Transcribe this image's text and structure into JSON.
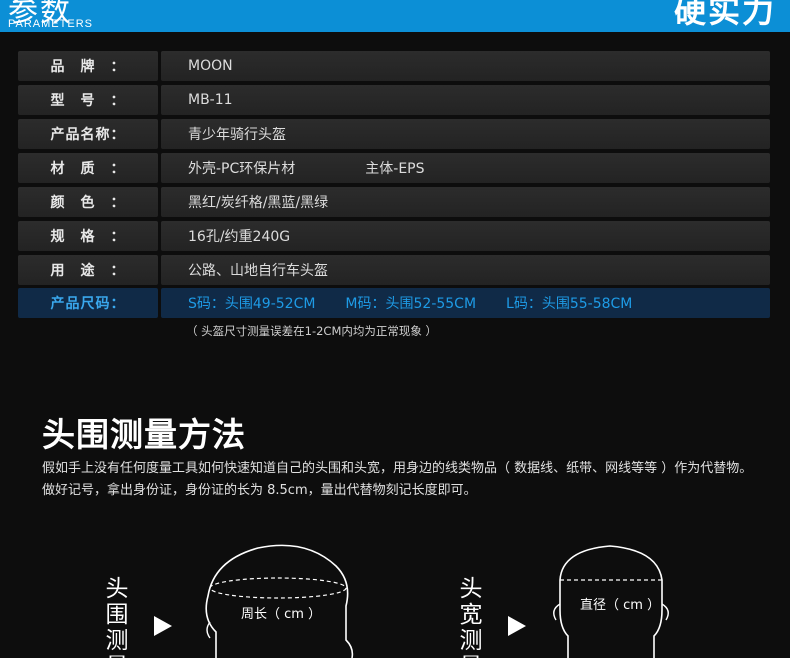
{
  "header": {
    "title": "参数",
    "subtitle": "PARAMETERS",
    "right_title": "硬实力"
  },
  "specs": [
    {
      "label": "品　牌　：",
      "value": "MOON"
    },
    {
      "label": "型　号　：",
      "value": "MB-11"
    },
    {
      "label": "产品名称：",
      "value": "青少年骑行头盔"
    },
    {
      "label": "材　质　：",
      "value": "外壳-PC环保片材",
      "value2": "主体-EPS"
    },
    {
      "label": "颜　色　：",
      "value": "黑红/炭纤格/黑蓝/黑绿"
    },
    {
      "label": "规　格　：",
      "value": "16孔/约重240G"
    },
    {
      "label": "用　途　：",
      "value": "公路、山地自行车头盔"
    }
  ],
  "size_row": {
    "label": "产品尺码：",
    "sizes": [
      "S码：头围49-52CM",
      "M码：头围52-55CM",
      "L码：头围55-58CM"
    ]
  },
  "note": "（ 头盔尺寸测量误差在1-2CM内均为正常现象 ）",
  "measure": {
    "title": "头围测量方法",
    "description": "假如手上没有任何度量工具如何快速知道自己的头围和头宽，用身边的线类物品（ 数据线、纸带、网线等等 ）作为代替物。做好记号，拿出身份证，身份证的长为 8.5cm，量出代替物刻记长度即可。",
    "left_label": "头围测量",
    "left_caption": "周长（ cm ）",
    "right_label": "头宽测量",
    "right_caption": "直径（ cm ）"
  },
  "colors": {
    "accent": "#0c8fd6",
    "highlight_bg": "#102a47",
    "highlight_text": "#1e9be6"
  }
}
